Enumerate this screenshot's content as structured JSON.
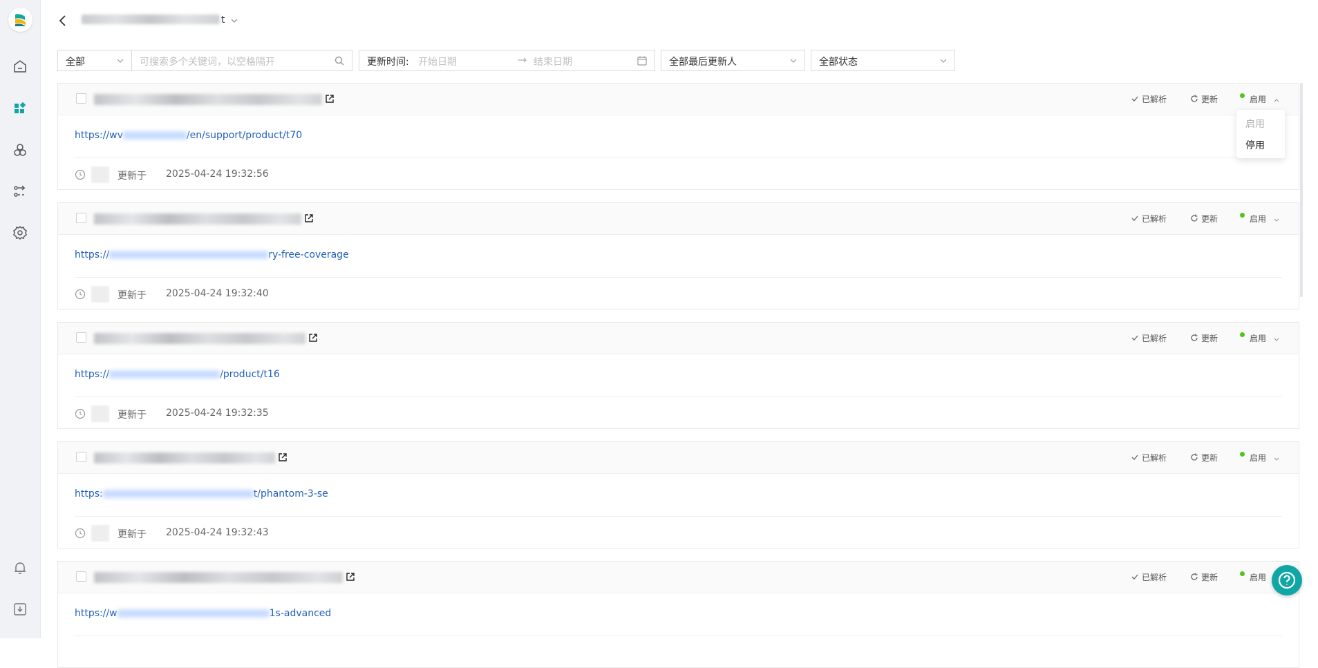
{
  "header": {
    "title_suffix": "t"
  },
  "filters": {
    "scope_select": "全部",
    "keyword_placeholder": "可搜索多个关键词，以空格隔开",
    "update_time_label": "更新时间:",
    "start_date_placeholder": "开始日期",
    "end_date_placeholder": "结束日期",
    "updater_select": "全部最后更新人",
    "status_select": "全部状态"
  },
  "item_actions": {
    "parsed": "已解析",
    "refresh": "更新",
    "status": "启用"
  },
  "items": [
    {
      "url_prefix": "https://wv",
      "url_suffix": "/en/support/product/t70",
      "updated_label": "更新于",
      "updated_at": "2025-04-24 19:32:56"
    },
    {
      "url_prefix": "https://",
      "url_suffix": "ry-free-coverage",
      "updated_label": "更新于",
      "updated_at": "2025-04-24 19:32:40"
    },
    {
      "url_prefix": "https://",
      "url_suffix": "/product/t16",
      "updated_label": "更新于",
      "updated_at": "2025-04-24 19:32:35"
    },
    {
      "url_prefix": "https:",
      "url_suffix": "t/phantom-3-se",
      "updated_label": "更新于",
      "updated_at": "2025-04-24 19:32:43"
    },
    {
      "url_prefix": "https://w",
      "url_suffix": "1s-advanced",
      "updated_label": "",
      "updated_at": ""
    }
  ],
  "status_dropdown": {
    "options": [
      "启用",
      "停用"
    ]
  },
  "colors": {
    "accent": "#11a6a6",
    "link": "#1f5fbf",
    "enabled_dot": "#52c41a"
  }
}
